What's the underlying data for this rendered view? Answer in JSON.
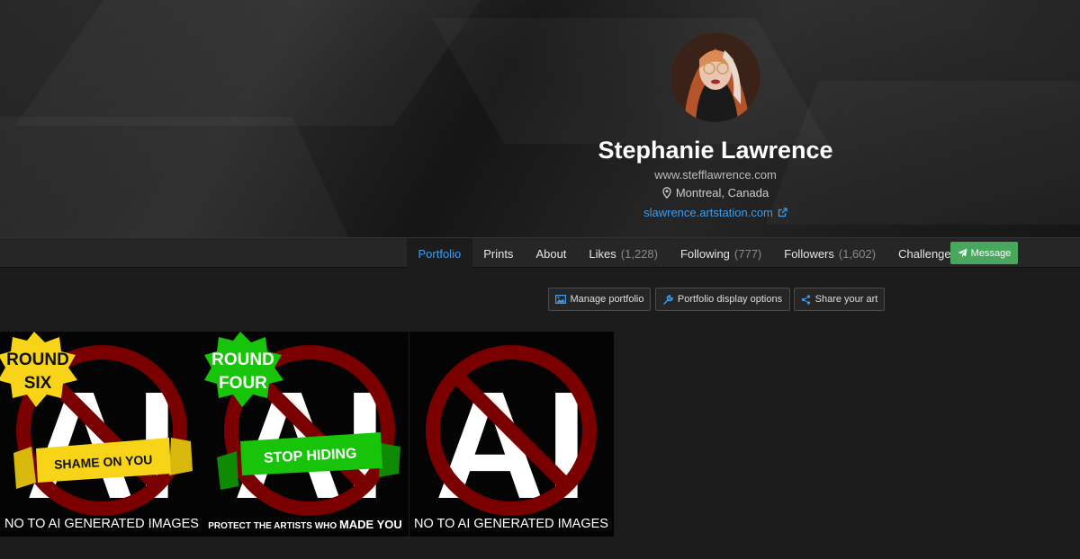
{
  "profile": {
    "name": "Stephanie Lawrence",
    "website": "www.stefflawrence.com",
    "location": "Montreal, Canada",
    "profile_link": "slawrence.artstation.com"
  },
  "nav": {
    "tabs": [
      {
        "label": "Portfolio",
        "count": "",
        "active": true
      },
      {
        "label": "Prints",
        "count": ""
      },
      {
        "label": "About",
        "count": ""
      },
      {
        "label": "Likes",
        "count": "(1,228)"
      },
      {
        "label": "Following",
        "count": "(777)"
      },
      {
        "label": "Followers",
        "count": "(1,602)"
      },
      {
        "label": "Challenges",
        "count": ""
      }
    ],
    "message_label": "Message"
  },
  "actions": {
    "manage_label": "Manage portfolio",
    "display_label": "Portfolio display options",
    "share_label": "Share your art"
  },
  "gallery": [
    {
      "badge_line1": "ROUND",
      "badge_line2": "SIX",
      "banner": "SHAME ON YOU",
      "caption": "NO TO AI GENERATED IMAGES",
      "center": "AI"
    },
    {
      "badge_line1": "ROUND",
      "badge_line2": "FOUR",
      "banner": "STOP HIDING",
      "caption_prefix": "PROTECT THE ARTISTS WHO ",
      "caption_bold": "MADE YOU",
      "center": "AI"
    },
    {
      "caption": "NO TO AI GENERATED IMAGES",
      "center": "AI"
    }
  ],
  "colors": {
    "accent": "#3c9df0",
    "message_green": "#47a85d",
    "badge_yellow": "#f7d417",
    "badge_green": "#17c40a",
    "prohibition_red": "#7a0000"
  }
}
